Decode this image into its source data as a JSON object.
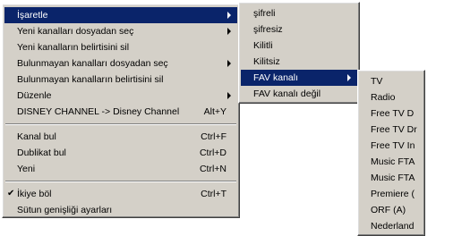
{
  "menu1": {
    "item_isaretle": "İşaretle",
    "item_new_from_file": "Yeni kanalları dosyadan seç",
    "item_delete_new_marker": "Yeni kanalların belirtisini sil",
    "item_missing_from_file": "Bulunmayan kanalları dosyadan seç",
    "item_delete_missing_marker": "Bulunmayan kanalların belirtisini sil",
    "item_duzenle": "Düzenle",
    "item_disney": "DISNEY CHANNEL -> Disney Channel",
    "item_disney_shortcut": "Alt+Y",
    "item_kanal_bul": "Kanal bul",
    "item_kanal_bul_shortcut": "Ctrl+F",
    "item_dublikat_bul": "Dublikat bul",
    "item_dublikat_bul_shortcut": "Ctrl+D",
    "item_yeni": "Yeni",
    "item_yeni_shortcut": "Ctrl+N",
    "item_ikiye_bol": "İkiye böl",
    "item_ikiye_bol_shortcut": "Ctrl+T",
    "item_sutun": "Sütun genişliği ayarları",
    "check_glyph": "✔"
  },
  "menu2": {
    "item_sifreli": "şifreli",
    "item_sifresiz": "şifresiz",
    "item_kilitli": "Kilitli",
    "item_kilitsiz": "Kilitsiz",
    "item_fav": "FAV kanalı",
    "item_fav_degil": "FAV kanalı değil"
  },
  "menu3": {
    "items": [
      "TV",
      "Radio",
      "Free TV D",
      "Free TV Dr",
      "Free TV In",
      "Music FTA",
      "Music FTA",
      "Premiere (",
      "ORF (A)",
      "Nederland"
    ]
  },
  "colors": {
    "menu_bg": "#d4d0c8",
    "highlight_bg": "#0a246a",
    "highlight_fg": "#ffffff"
  }
}
